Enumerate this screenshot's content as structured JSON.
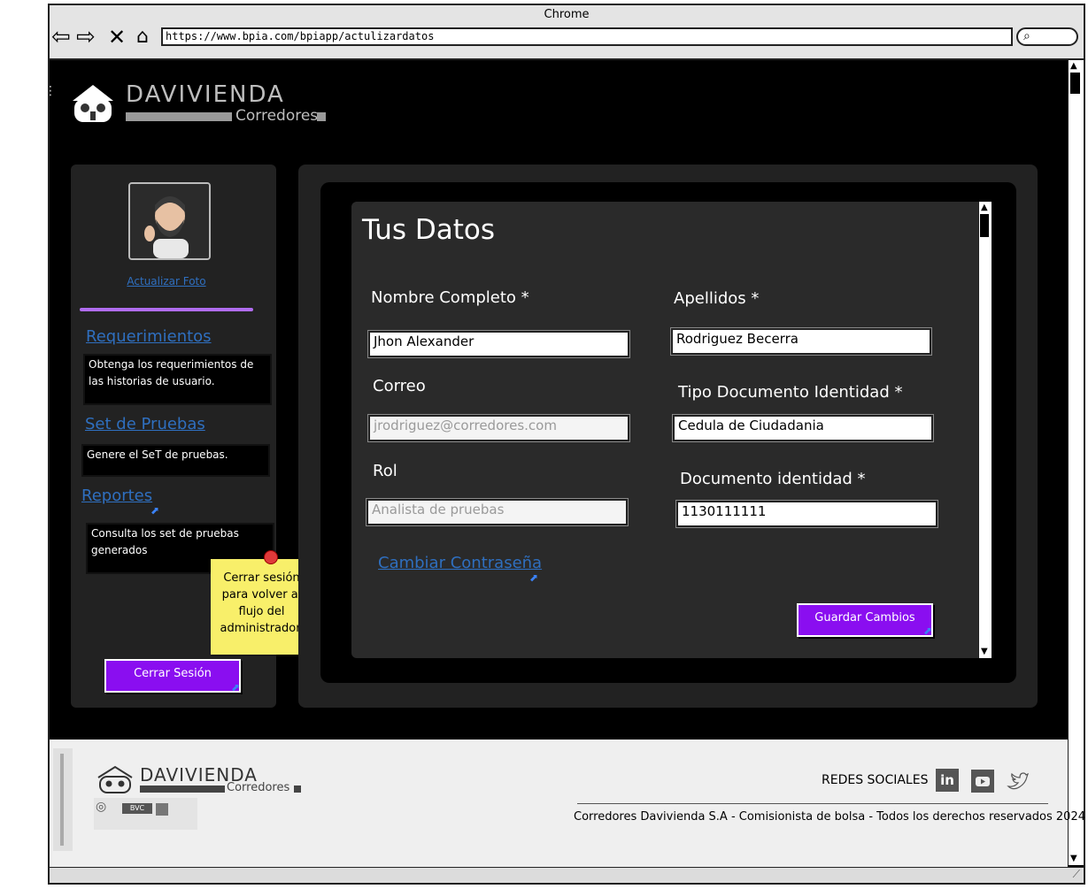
{
  "browser": {
    "title": "Chrome",
    "url": "https://www.bpia.com/bpiapp/actulizardatos",
    "search_icon": "search-icon"
  },
  "brand": {
    "name": "DAVIVIENDA",
    "sub": "Corredores"
  },
  "sidebar": {
    "photo_link": "Actualizar Foto",
    "items": [
      {
        "label": "Requerimientos",
        "desc": "Obtenga los requerimientos de las historias de usuario."
      },
      {
        "label": "Set de Pruebas",
        "desc": "Genere el SeT de pruebas."
      },
      {
        "label": "Reportes",
        "desc": "Consulta los set de pruebas generados"
      }
    ],
    "sticky_note": "Cerrar sesión para volver al flujo del administrador.",
    "logout_label": "Cerrar Sesión"
  },
  "form": {
    "title": "Tus Datos",
    "fields": {
      "nombre": {
        "label": "Nombre Completo *",
        "value": "Jhon Alexander"
      },
      "apellidos": {
        "label": "Apellidos *",
        "value": "Rodriguez Becerra"
      },
      "correo": {
        "label": "Correo",
        "value": "jrodriguez@corredores.com"
      },
      "tipo_doc": {
        "label": "Tipo Documento Identidad *",
        "value": "Cedula de Ciudadania"
      },
      "rol": {
        "label": "Rol",
        "value": "Analista de pruebas"
      },
      "doc": {
        "label": "Documento identidad *",
        "value": "1130111111"
      }
    },
    "change_password": "Cambiar Contraseña",
    "save_label": "Guardar Cambios"
  },
  "footer": {
    "social_label": "REDES SOCIALES",
    "copyright": "Corredores Davivienda S.A - Comisionista de bolsa - Todos los derechos reservados 2024",
    "badge_text": "BVC"
  },
  "colors": {
    "accent": "#8a0ef0",
    "link": "#2f6fbf",
    "background": "#000000",
    "panel": "#222222"
  }
}
